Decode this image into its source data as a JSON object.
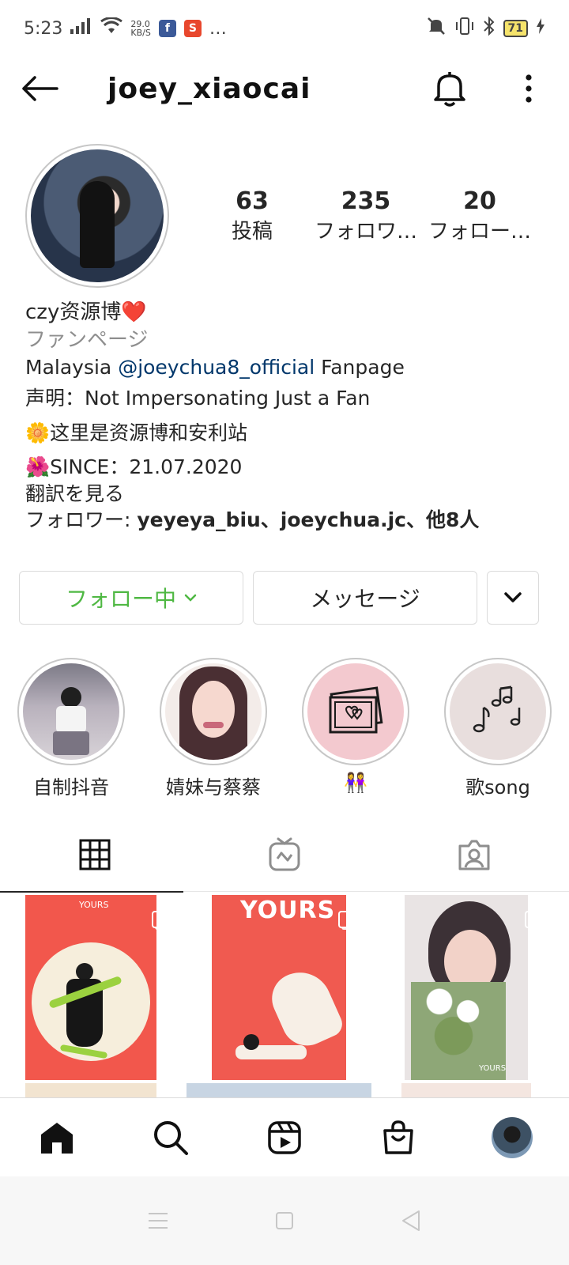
{
  "status_bar": {
    "time": "5:23",
    "net_speed_top": "29.0",
    "net_speed_bottom": "KB/S",
    "more": "…",
    "battery": "71"
  },
  "header": {
    "username": "joey_xiaocai"
  },
  "profile": {
    "stats": [
      {
        "value": "63",
        "label": "投稿"
      },
      {
        "value": "235",
        "label": "フォロワ…"
      },
      {
        "value": "20",
        "label": "フォロー…"
      }
    ],
    "bio": {
      "name": "czy资源博❤️",
      "category": "ファンページ",
      "line1_prefix": "Malaysia ",
      "line1_mention": "@joeychua8_official",
      "line1_suffix": " Fanpage",
      "line2": "声明：Not Impersonating Just a Fan",
      "line3": "🌼这里是资源博和安利站",
      "line4": "🌺SINCE：21.07.2020",
      "translate": "翻訳を見る",
      "followed_by_prefix": "フォロワー: ",
      "followed_by_names": "yeyeya_biu、joeychua.jc、他8人"
    }
  },
  "actions": {
    "following_label": "フォロー中",
    "message_label": "メッセージ"
  },
  "highlights": [
    {
      "label": "自制抖音"
    },
    {
      "label": "婧妹与蔡蔡"
    },
    {
      "label": "👭"
    },
    {
      "label": "歌song"
    }
  ],
  "posts": [
    {
      "caption": "YOURS"
    },
    {
      "caption": "YOURS"
    },
    {
      "caption": "YOURS"
    }
  ],
  "colors": {
    "following_green": "#4fb843",
    "mention_blue": "#00376b",
    "muted_gray": "#8e8e8e"
  }
}
